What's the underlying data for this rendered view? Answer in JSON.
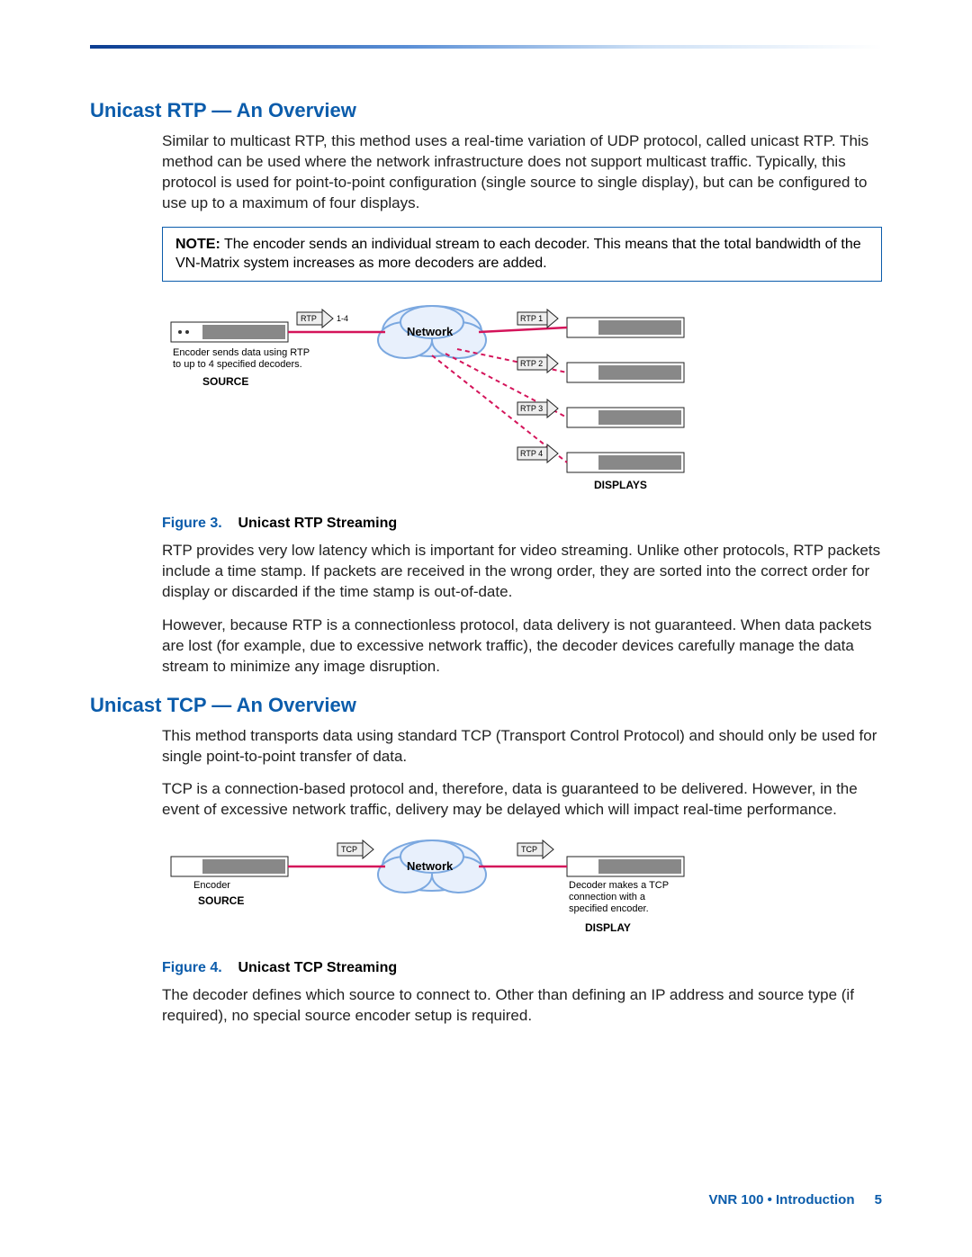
{
  "section1": {
    "title": "Unicast RTP — An Overview",
    "para1": "Similar to multicast RTP, this method uses a real-time variation of UDP protocol, called unicast RTP. This method can be used where the network infrastructure does not support multicast traffic. Typically, this protocol is used for point-to-point configuration (single source to single display), but can be configured to use up to a maximum of four displays.",
    "note_label": "NOTE:",
    "note_text": "The encoder sends an individual stream to each decoder. This means that the total bandwidth of the VN-Matrix system increases as more decoders are added.",
    "fig3_num": "Figure 3.",
    "fig3_title": "Unicast RTP Streaming",
    "para2": "RTP provides very low latency which is important for video streaming. Unlike other protocols, RTP packets include a time stamp. If packets are received in the wrong order, they are sorted into the correct order for display or discarded if the time stamp is out-of-date.",
    "para3": "However, because RTP is a connectionless protocol, data delivery is not guaranteed. When data packets are lost (for example, due to excessive network traffic), the decoder devices carefully manage the data stream to minimize any image disruption."
  },
  "diagram1": {
    "rtp_src": "RTP",
    "rtp_src_range": "1-4",
    "network": "Network",
    "rtp1": "RTP 1",
    "rtp2": "RTP 2",
    "rtp3": "RTP 3",
    "rtp4": "RTP 4",
    "caption1": "Encoder sends data using RTP",
    "caption2": "to up to 4 specified decoders.",
    "source": "SOURCE",
    "displays": "DISPLAYS"
  },
  "section2": {
    "title": "Unicast TCP — An Overview",
    "para1": "This method transports data using standard TCP (Transport Control Protocol) and should only be used for single point-to-point transfer of data.",
    "para2": "TCP is a connection-based protocol and, therefore, data is guaranteed to be delivered. However, in the event of excessive network traffic, delivery may be delayed which will impact real-time performance.",
    "fig4_num": "Figure 4.",
    "fig4_title": "Unicast TCP Streaming",
    "para3": "The decoder defines which source to connect to. Other than defining an IP address and source type (if required), no special source encoder setup is required."
  },
  "diagram2": {
    "tcp1": "TCP",
    "tcp2": "TCP",
    "network": "Network",
    "encoder": "Encoder",
    "source": "SOURCE",
    "dec1": "Decoder makes a TCP",
    "dec2": "connection with a",
    "dec3": "specified encoder.",
    "display": "DISPLAY"
  },
  "footer": {
    "text": "VNR 100 • Introduction",
    "page": "5"
  }
}
